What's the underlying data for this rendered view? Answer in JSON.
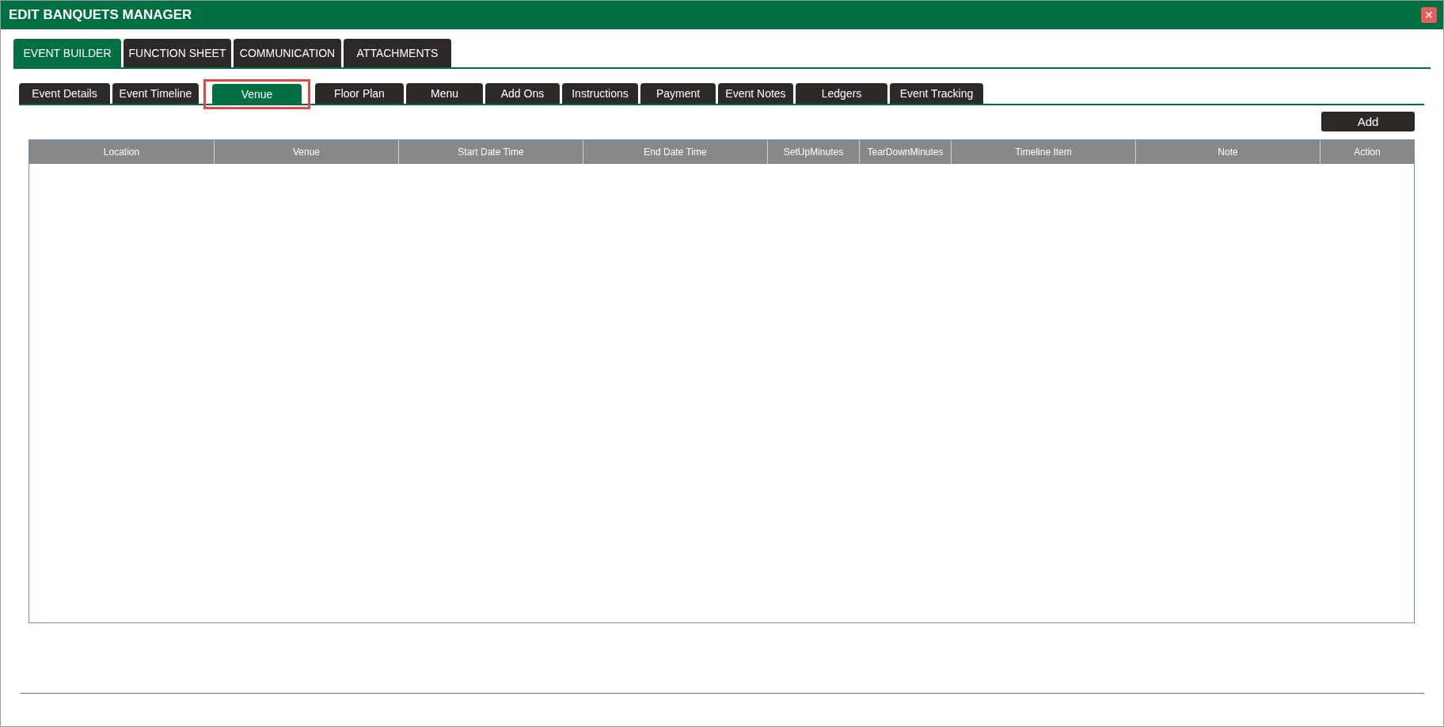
{
  "window": {
    "title": "EDIT BANQUETS MANAGER",
    "close_label": "✕"
  },
  "main_tabs": [
    {
      "label": "EVENT BUILDER",
      "selected": true
    },
    {
      "label": "FUNCTION SHEET",
      "selected": false
    },
    {
      "label": "COMMUNICATION",
      "selected": false
    },
    {
      "label": "ATTACHMENTS",
      "selected": false
    }
  ],
  "sub_tabs": [
    {
      "label": "Event Details",
      "selected": false,
      "highlighted": false
    },
    {
      "label": "Event Timeline",
      "selected": false,
      "highlighted": false
    },
    {
      "label": "Venue",
      "selected": true,
      "highlighted": true
    },
    {
      "label": "Floor Plan",
      "selected": false,
      "highlighted": false
    },
    {
      "label": "Menu",
      "selected": false,
      "highlighted": false
    },
    {
      "label": "Add Ons",
      "selected": false,
      "highlighted": false
    },
    {
      "label": "Instructions",
      "selected": false,
      "highlighted": false
    },
    {
      "label": "Payment",
      "selected": false,
      "highlighted": false
    },
    {
      "label": "Event Notes",
      "selected": false,
      "highlighted": false
    },
    {
      "label": "Ledgers",
      "selected": false,
      "highlighted": false
    },
    {
      "label": "Event Tracking",
      "selected": false,
      "highlighted": false
    }
  ],
  "add_button": "Add",
  "table": {
    "columns": [
      "Location",
      "Venue",
      "Start Date Time",
      "End Date Time",
      "SetUpMinutes",
      "TearDownMinutes",
      "Timeline Item",
      "Note",
      "Action"
    ]
  }
}
